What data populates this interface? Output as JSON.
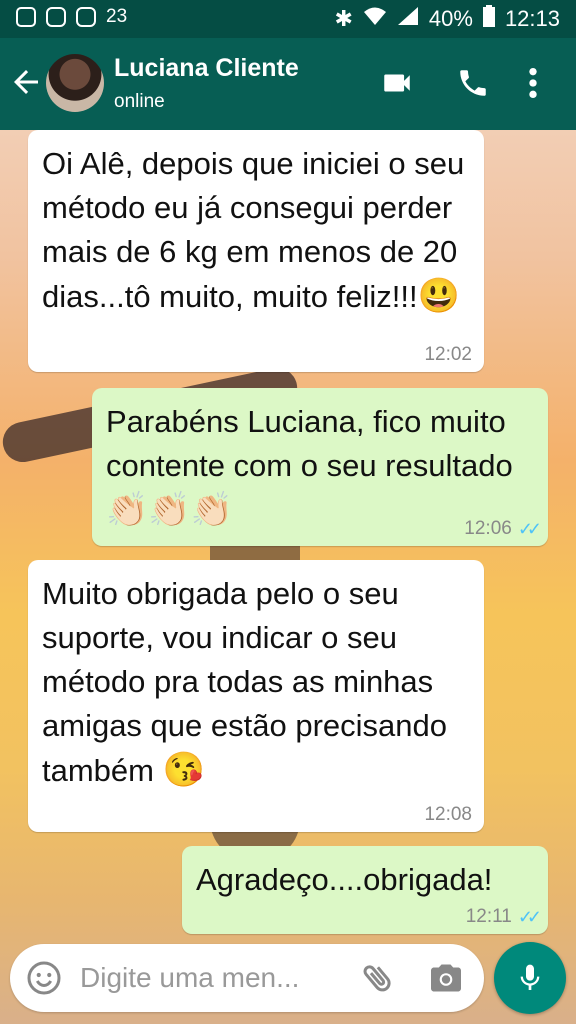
{
  "statusbar": {
    "notification_count": "23",
    "battery": "40%",
    "clock": "12:13"
  },
  "header": {
    "contact_name": "Luciana Cliente",
    "status": "online",
    "icons": [
      "back-arrow-icon",
      "videocam-icon",
      "phone-icon",
      "more-vert-icon"
    ]
  },
  "messages": [
    {
      "direction": "incoming",
      "text": "Oi Alê, depois que iniciei o seu método eu já consegui perder mais de 6 kg em menos de 20 dias...tô muito, muito feliz!!!",
      "emoji": "😃",
      "time": "12:02"
    },
    {
      "direction": "outgoing",
      "text": "Parabéns Luciana, fico muito contente com o seu resultado",
      "emoji": "👏🏻👏🏻👏🏻",
      "time": "12:06",
      "ticks": "✓✓"
    },
    {
      "direction": "incoming",
      "text": "Muito obrigada pelo o seu suporte, vou indicar o seu método pra todas as minhas amigas que estão precisando também",
      "emoji": "😘",
      "time": "12:08"
    },
    {
      "direction": "outgoing",
      "text": "Agradeço....obrigada!",
      "time": "12:11",
      "ticks": "✓✓"
    }
  ],
  "composer": {
    "placeholder": "Digite uma men..."
  },
  "colors": {
    "header": "#075e54",
    "statusbar": "#054d44",
    "outgoing_bubble": "#dcf8c6",
    "incoming_bubble": "#ffffff",
    "read_ticks": "#4fc3f7",
    "mic_button": "#00897b"
  }
}
